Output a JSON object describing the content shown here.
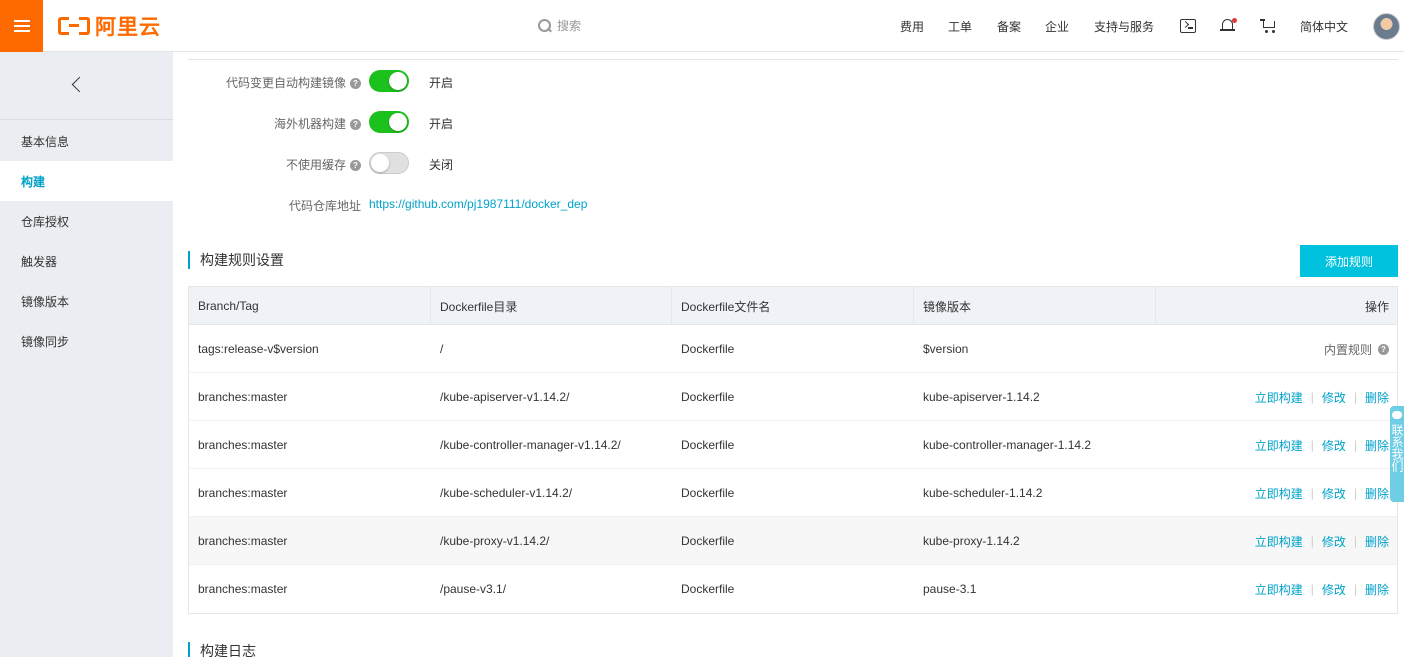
{
  "topbar": {
    "brand": "阿里云",
    "search_placeholder": "搜索",
    "nav": [
      "费用",
      "工单",
      "备案",
      "企业",
      "支持与服务"
    ],
    "language": "简体中文",
    "accent": "#ff6a00"
  },
  "sidebar": {
    "items": [
      {
        "label": "基本信息",
        "active": false
      },
      {
        "label": "构建",
        "active": true
      },
      {
        "label": "仓库授权",
        "active": false
      },
      {
        "label": "触发器",
        "active": false
      },
      {
        "label": "镜像版本",
        "active": false
      },
      {
        "label": "镜像同步",
        "active": false
      }
    ]
  },
  "settings": {
    "auto_build": {
      "label": "代码变更自动构建镜像",
      "state": "开启",
      "enabled": true
    },
    "overseas_build": {
      "label": "海外机器构建",
      "state": "开启",
      "enabled": true
    },
    "no_cache": {
      "label": "不使用缓存",
      "state": "关闭",
      "enabled": false
    },
    "repo": {
      "label": "代码仓库地址",
      "url": "https://github.com/pj1987111/docker_dep"
    }
  },
  "rules": {
    "title": "构建规则设置",
    "add_button": "添加规则",
    "columns": [
      "Branch/Tag",
      "Dockerfile目录",
      "Dockerfile文件名",
      "镜像版本",
      "操作"
    ],
    "builtin_label": "内置规则",
    "op_build": "立即构建",
    "op_edit": "修改",
    "op_delete": "删除",
    "rows": [
      {
        "branch": "tags:release-v$version",
        "dir": "/",
        "file": "Dockerfile",
        "version": "$version",
        "builtin": true
      },
      {
        "branch": "branches:master",
        "dir": "/kube-apiserver-v1.14.2/",
        "file": "Dockerfile",
        "version": "kube-apiserver-1.14.2",
        "builtin": false
      },
      {
        "branch": "branches:master",
        "dir": "/kube-controller-manager-v1.14.2/",
        "file": "Dockerfile",
        "version": "kube-controller-manager-1.14.2",
        "builtin": false
      },
      {
        "branch": "branches:master",
        "dir": "/kube-scheduler-v1.14.2/",
        "file": "Dockerfile",
        "version": "kube-scheduler-1.14.2",
        "builtin": false
      },
      {
        "branch": "branches:master",
        "dir": "/kube-proxy-v1.14.2/",
        "file": "Dockerfile",
        "version": "kube-proxy-1.14.2",
        "builtin": false
      },
      {
        "branch": "branches:master",
        "dir": "/pause-v3.1/",
        "file": "Dockerfile",
        "version": "pause-3.1",
        "builtin": false
      }
    ]
  },
  "logs": {
    "title": "构建日志"
  },
  "float_contact": {
    "text": "联系我们"
  },
  "colors": {
    "link": "#00a2ca",
    "toggle_on": "#1dc11d",
    "button": "#00c1de"
  }
}
